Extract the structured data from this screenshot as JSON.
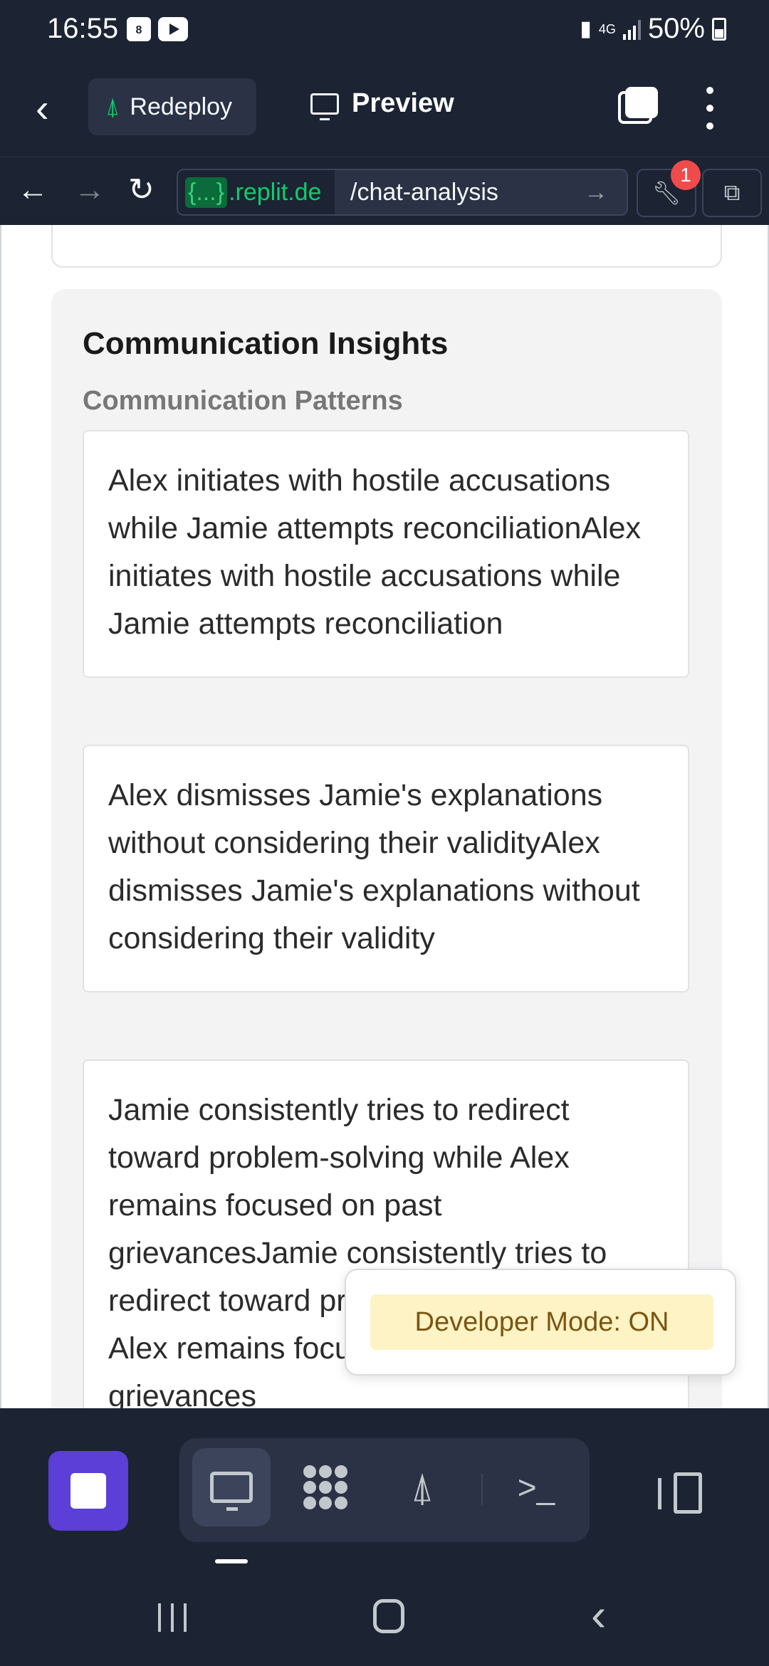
{
  "status_bar": {
    "time": "16:55",
    "calendar_day": "8",
    "network": "4G",
    "battery": "50%"
  },
  "toolbar": {
    "redeploy_label": "Redeploy",
    "preview_label": "Preview"
  },
  "address_bar": {
    "host": ".replit.de",
    "host_tag": "{...}",
    "path": "/chat-analysis",
    "devtools_badge": "1"
  },
  "insights": {
    "title": "Communication Insights",
    "patterns_title": "Communication Patterns",
    "patterns": [
      "Alex initiates with hostile accusations while Jamie attempts reconciliationAlex initiates with hostile accusations while Jamie attempts reconciliation",
      "Alex dismisses Jamie's explanations without considering their validityAlex dismisses Jamie's explanations without considering their validity",
      "Jamie consistently tries to redirect toward problem-solving while Alex remains focused on past grievancesJamie consistently tries to redirect toward problem-solving while Alex remains focused on past grievances"
    ]
  },
  "developer_toast": {
    "label": "Developer Mode: ON"
  },
  "colors": {
    "bar_bg": "#1c2333",
    "accent_purple": "#5b3fd6",
    "url_green": "#0cce6b",
    "badge_red": "#f04b4b",
    "toast_bg": "#fdf3c4"
  }
}
